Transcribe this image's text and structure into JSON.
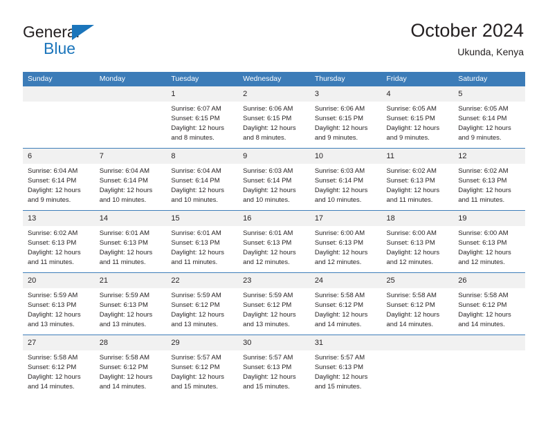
{
  "brand": {
    "line1": "General",
    "line2": "Blue",
    "triangle_color": "#1b75bb",
    "text_color": "#231f20"
  },
  "header": {
    "title": "October 2024",
    "subtitle": "Ukunda, Kenya"
  },
  "theme": {
    "header_blue": "#3c7cb8",
    "daynum_gray": "#f1f1f1",
    "row_rule": "#3c7cb8",
    "text": "#231f20"
  },
  "weekdays": [
    "Sunday",
    "Monday",
    "Tuesday",
    "Wednesday",
    "Thursday",
    "Friday",
    "Saturday"
  ],
  "weeks": [
    [
      {
        "day": "",
        "sunrise": "",
        "sunset": "",
        "daylight1": "",
        "daylight2": ""
      },
      {
        "day": "",
        "sunrise": "",
        "sunset": "",
        "daylight1": "",
        "daylight2": ""
      },
      {
        "day": "1",
        "sunrise": "Sunrise: 6:07 AM",
        "sunset": "Sunset: 6:15 PM",
        "daylight1": "Daylight: 12 hours",
        "daylight2": "and 8 minutes."
      },
      {
        "day": "2",
        "sunrise": "Sunrise: 6:06 AM",
        "sunset": "Sunset: 6:15 PM",
        "daylight1": "Daylight: 12 hours",
        "daylight2": "and 8 minutes."
      },
      {
        "day": "3",
        "sunrise": "Sunrise: 6:06 AM",
        "sunset": "Sunset: 6:15 PM",
        "daylight1": "Daylight: 12 hours",
        "daylight2": "and 9 minutes."
      },
      {
        "day": "4",
        "sunrise": "Sunrise: 6:05 AM",
        "sunset": "Sunset: 6:15 PM",
        "daylight1": "Daylight: 12 hours",
        "daylight2": "and 9 minutes."
      },
      {
        "day": "5",
        "sunrise": "Sunrise: 6:05 AM",
        "sunset": "Sunset: 6:14 PM",
        "daylight1": "Daylight: 12 hours",
        "daylight2": "and 9 minutes."
      }
    ],
    [
      {
        "day": "6",
        "sunrise": "Sunrise: 6:04 AM",
        "sunset": "Sunset: 6:14 PM",
        "daylight1": "Daylight: 12 hours",
        "daylight2": "and 9 minutes."
      },
      {
        "day": "7",
        "sunrise": "Sunrise: 6:04 AM",
        "sunset": "Sunset: 6:14 PM",
        "daylight1": "Daylight: 12 hours",
        "daylight2": "and 10 minutes."
      },
      {
        "day": "8",
        "sunrise": "Sunrise: 6:04 AM",
        "sunset": "Sunset: 6:14 PM",
        "daylight1": "Daylight: 12 hours",
        "daylight2": "and 10 minutes."
      },
      {
        "day": "9",
        "sunrise": "Sunrise: 6:03 AM",
        "sunset": "Sunset: 6:14 PM",
        "daylight1": "Daylight: 12 hours",
        "daylight2": "and 10 minutes."
      },
      {
        "day": "10",
        "sunrise": "Sunrise: 6:03 AM",
        "sunset": "Sunset: 6:14 PM",
        "daylight1": "Daylight: 12 hours",
        "daylight2": "and 10 minutes."
      },
      {
        "day": "11",
        "sunrise": "Sunrise: 6:02 AM",
        "sunset": "Sunset: 6:13 PM",
        "daylight1": "Daylight: 12 hours",
        "daylight2": "and 11 minutes."
      },
      {
        "day": "12",
        "sunrise": "Sunrise: 6:02 AM",
        "sunset": "Sunset: 6:13 PM",
        "daylight1": "Daylight: 12 hours",
        "daylight2": "and 11 minutes."
      }
    ],
    [
      {
        "day": "13",
        "sunrise": "Sunrise: 6:02 AM",
        "sunset": "Sunset: 6:13 PM",
        "daylight1": "Daylight: 12 hours",
        "daylight2": "and 11 minutes."
      },
      {
        "day": "14",
        "sunrise": "Sunrise: 6:01 AM",
        "sunset": "Sunset: 6:13 PM",
        "daylight1": "Daylight: 12 hours",
        "daylight2": "and 11 minutes."
      },
      {
        "day": "15",
        "sunrise": "Sunrise: 6:01 AM",
        "sunset": "Sunset: 6:13 PM",
        "daylight1": "Daylight: 12 hours",
        "daylight2": "and 11 minutes."
      },
      {
        "day": "16",
        "sunrise": "Sunrise: 6:01 AM",
        "sunset": "Sunset: 6:13 PM",
        "daylight1": "Daylight: 12 hours",
        "daylight2": "and 12 minutes."
      },
      {
        "day": "17",
        "sunrise": "Sunrise: 6:00 AM",
        "sunset": "Sunset: 6:13 PM",
        "daylight1": "Daylight: 12 hours",
        "daylight2": "and 12 minutes."
      },
      {
        "day": "18",
        "sunrise": "Sunrise: 6:00 AM",
        "sunset": "Sunset: 6:13 PM",
        "daylight1": "Daylight: 12 hours",
        "daylight2": "and 12 minutes."
      },
      {
        "day": "19",
        "sunrise": "Sunrise: 6:00 AM",
        "sunset": "Sunset: 6:13 PM",
        "daylight1": "Daylight: 12 hours",
        "daylight2": "and 12 minutes."
      }
    ],
    [
      {
        "day": "20",
        "sunrise": "Sunrise: 5:59 AM",
        "sunset": "Sunset: 6:13 PM",
        "daylight1": "Daylight: 12 hours",
        "daylight2": "and 13 minutes."
      },
      {
        "day": "21",
        "sunrise": "Sunrise: 5:59 AM",
        "sunset": "Sunset: 6:13 PM",
        "daylight1": "Daylight: 12 hours",
        "daylight2": "and 13 minutes."
      },
      {
        "day": "22",
        "sunrise": "Sunrise: 5:59 AM",
        "sunset": "Sunset: 6:12 PM",
        "daylight1": "Daylight: 12 hours",
        "daylight2": "and 13 minutes."
      },
      {
        "day": "23",
        "sunrise": "Sunrise: 5:59 AM",
        "sunset": "Sunset: 6:12 PM",
        "daylight1": "Daylight: 12 hours",
        "daylight2": "and 13 minutes."
      },
      {
        "day": "24",
        "sunrise": "Sunrise: 5:58 AM",
        "sunset": "Sunset: 6:12 PM",
        "daylight1": "Daylight: 12 hours",
        "daylight2": "and 14 minutes."
      },
      {
        "day": "25",
        "sunrise": "Sunrise: 5:58 AM",
        "sunset": "Sunset: 6:12 PM",
        "daylight1": "Daylight: 12 hours",
        "daylight2": "and 14 minutes."
      },
      {
        "day": "26",
        "sunrise": "Sunrise: 5:58 AM",
        "sunset": "Sunset: 6:12 PM",
        "daylight1": "Daylight: 12 hours",
        "daylight2": "and 14 minutes."
      }
    ],
    [
      {
        "day": "27",
        "sunrise": "Sunrise: 5:58 AM",
        "sunset": "Sunset: 6:12 PM",
        "daylight1": "Daylight: 12 hours",
        "daylight2": "and 14 minutes."
      },
      {
        "day": "28",
        "sunrise": "Sunrise: 5:58 AM",
        "sunset": "Sunset: 6:12 PM",
        "daylight1": "Daylight: 12 hours",
        "daylight2": "and 14 minutes."
      },
      {
        "day": "29",
        "sunrise": "Sunrise: 5:57 AM",
        "sunset": "Sunset: 6:12 PM",
        "daylight1": "Daylight: 12 hours",
        "daylight2": "and 15 minutes."
      },
      {
        "day": "30",
        "sunrise": "Sunrise: 5:57 AM",
        "sunset": "Sunset: 6:13 PM",
        "daylight1": "Daylight: 12 hours",
        "daylight2": "and 15 minutes."
      },
      {
        "day": "31",
        "sunrise": "Sunrise: 5:57 AM",
        "sunset": "Sunset: 6:13 PM",
        "daylight1": "Daylight: 12 hours",
        "daylight2": "and 15 minutes."
      },
      {
        "day": "",
        "sunrise": "",
        "sunset": "",
        "daylight1": "",
        "daylight2": ""
      },
      {
        "day": "",
        "sunrise": "",
        "sunset": "",
        "daylight1": "",
        "daylight2": ""
      }
    ]
  ]
}
